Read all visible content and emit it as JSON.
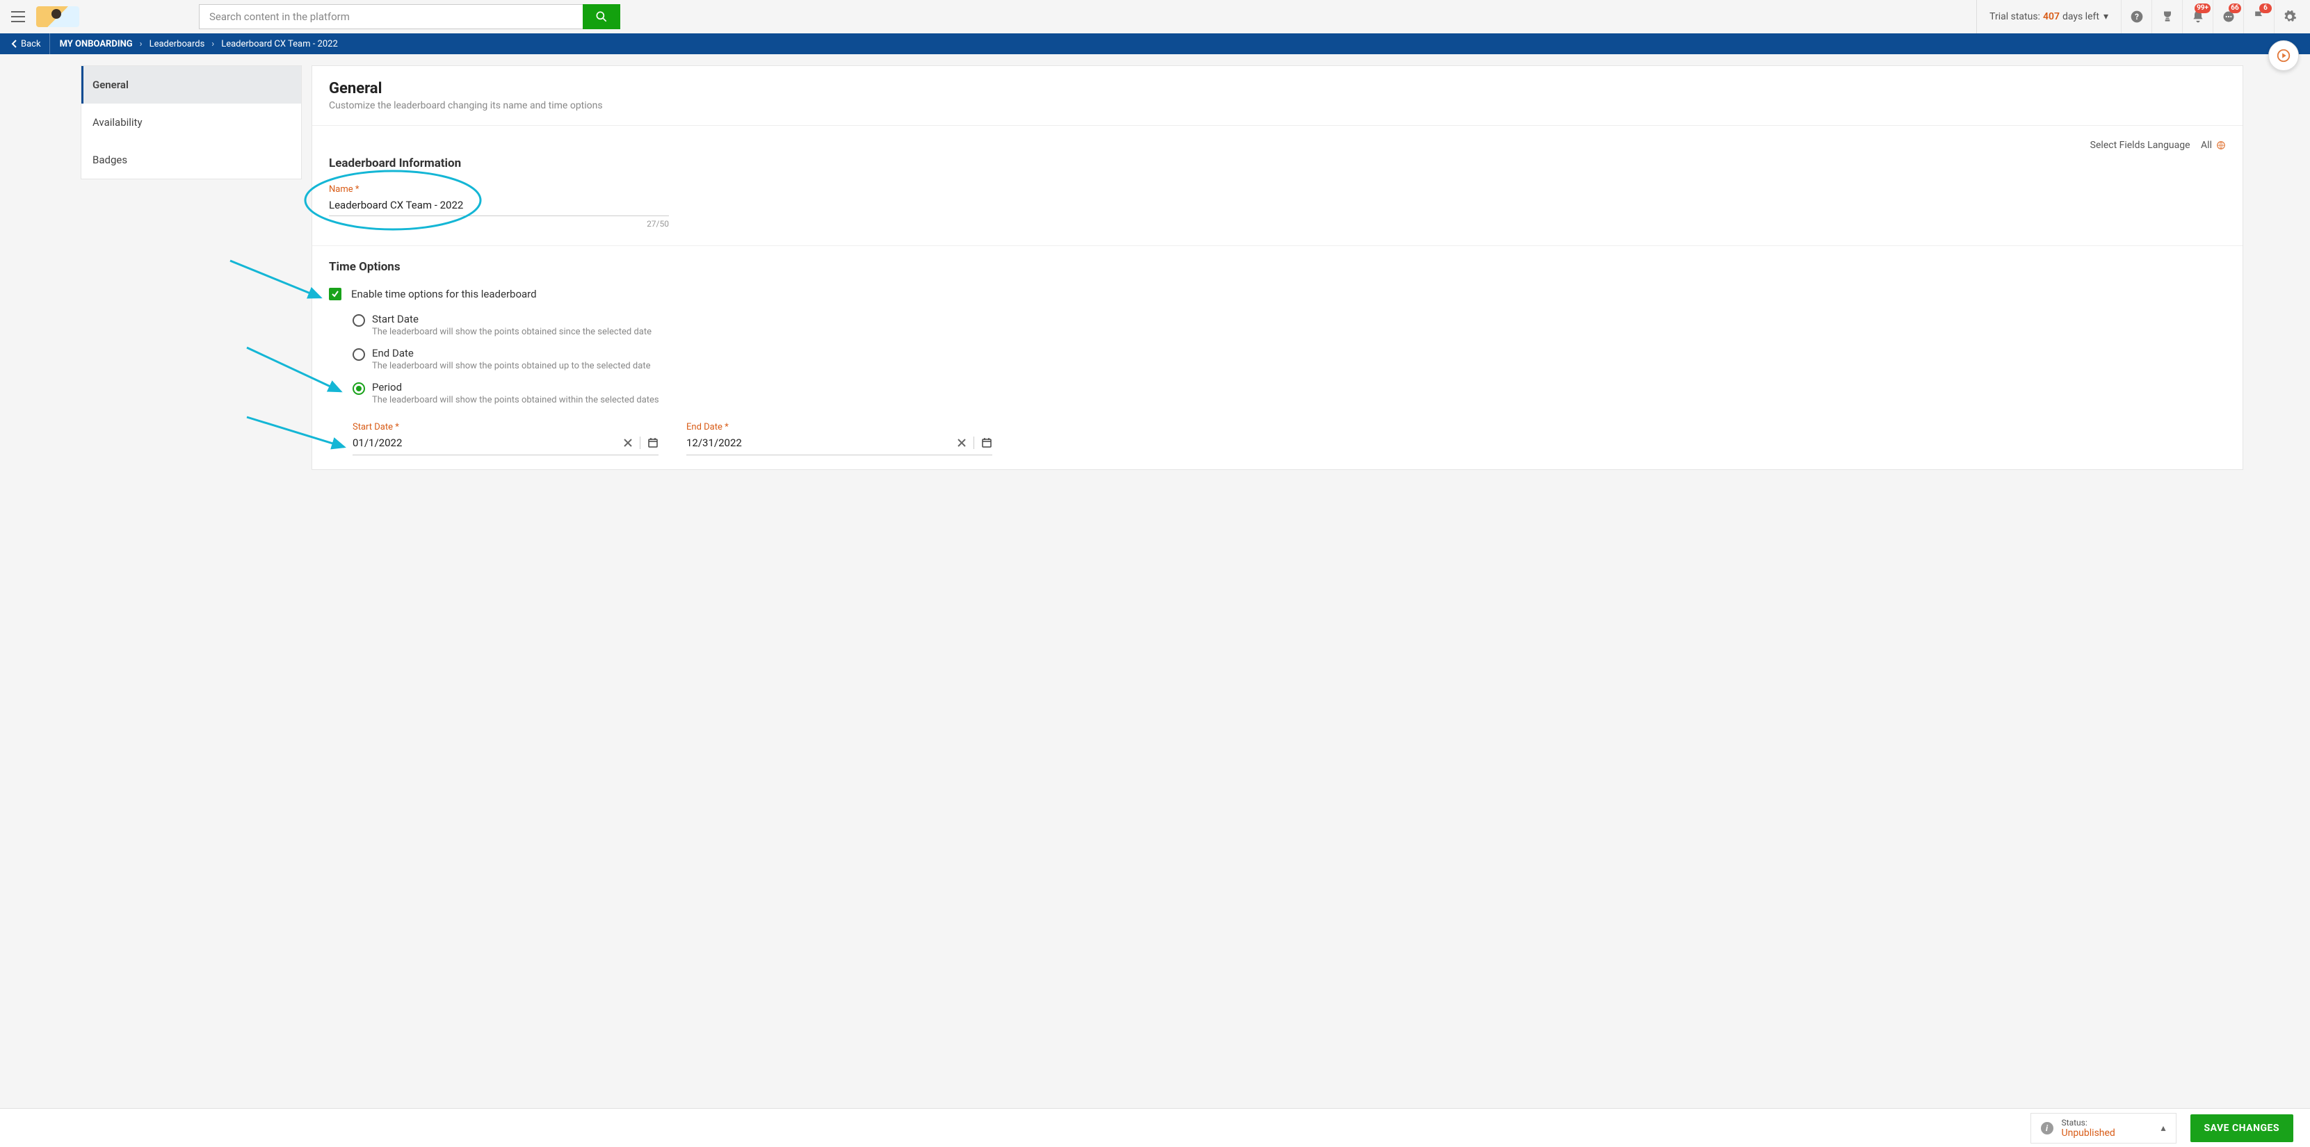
{
  "topbar": {
    "search_placeholder": "Search content in the platform",
    "trial_prefix": "Trial status:",
    "trial_days": "407",
    "trial_suffix": "days left",
    "badges": {
      "bell": "99+",
      "chat": "66",
      "flag": "6"
    }
  },
  "crumbs": {
    "back": "Back",
    "root": "MY ONBOARDING",
    "mid": "Leaderboards",
    "current": "Leaderboard CX Team - 2022"
  },
  "sidenav": {
    "general": "General",
    "availability": "Availability",
    "badges": "Badges"
  },
  "general": {
    "heading": "General",
    "sub": "Customize the leaderboard changing its name and time options"
  },
  "fieldsLang": {
    "label": "Select Fields Language",
    "value": "All"
  },
  "info": {
    "heading": "Leaderboard Information",
    "name_label": "Name",
    "name_value": "Leaderboard CX Team - 2022",
    "name_counter": "27/50"
  },
  "time": {
    "heading": "Time Options",
    "enable_label": "Enable time options for this leaderboard",
    "radios": {
      "start": {
        "label": "Start Date",
        "desc": "The leaderboard will show the points obtained since the selected date"
      },
      "end": {
        "label": "End Date",
        "desc": "The leaderboard will show the points obtained up to the selected date"
      },
      "period": {
        "label": "Period",
        "desc": "The leaderboard will show the points obtained within the selected dates"
      }
    },
    "start_date_label": "Start Date",
    "start_date_value": "01/1/2022",
    "end_date_label": "End Date",
    "end_date_value": "12/31/2022"
  },
  "footer": {
    "status_label": "Status:",
    "status_value": "Unpublished",
    "save": "SAVE CHANGES"
  }
}
